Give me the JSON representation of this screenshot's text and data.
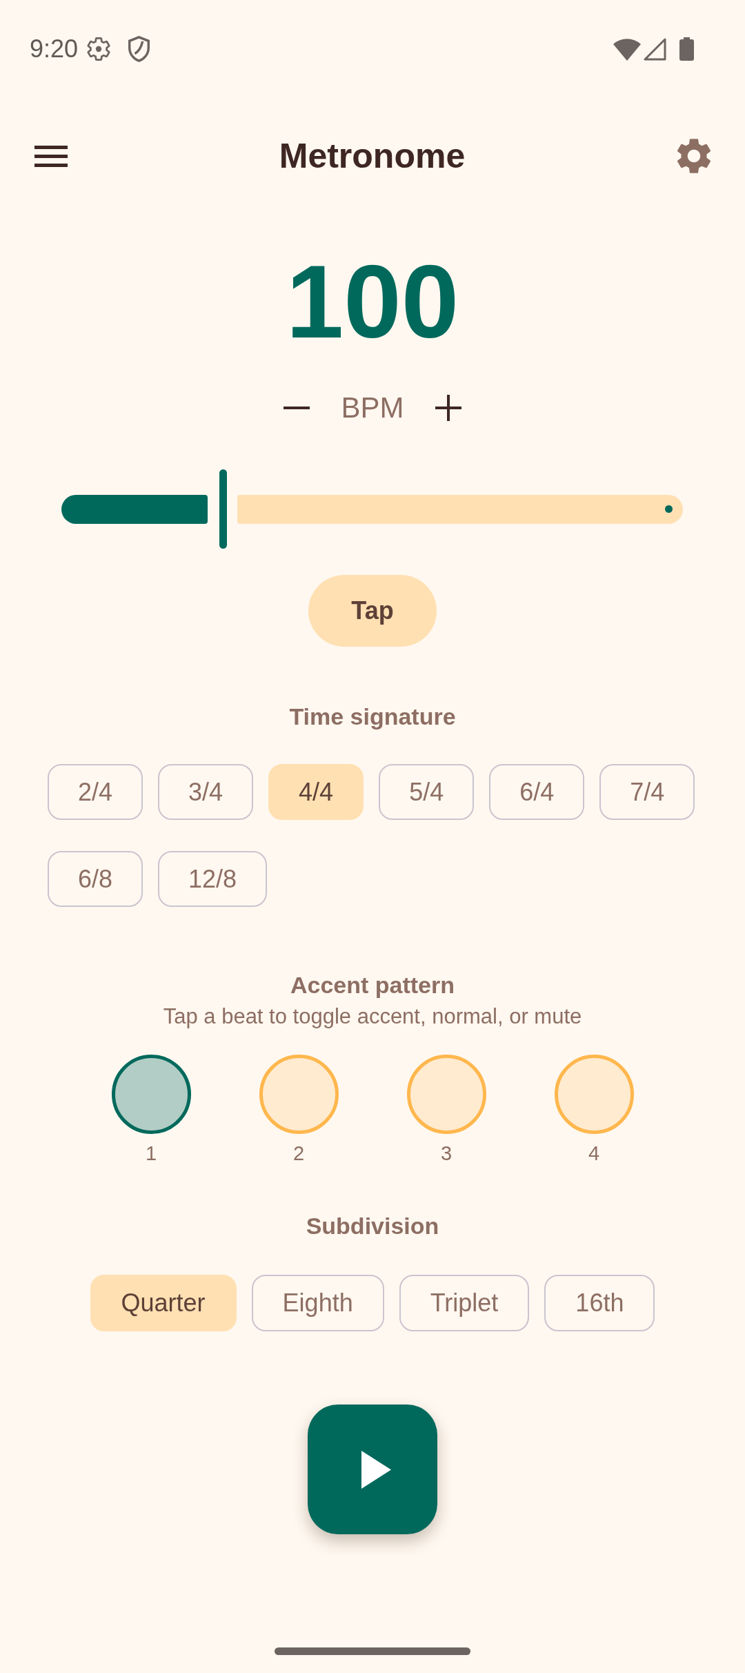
{
  "status_bar": {
    "time": "9:20"
  },
  "app_bar": {
    "title": "Metronome"
  },
  "tempo": {
    "value": "100",
    "unit": "BPM",
    "slider": {
      "level": 0.26
    }
  },
  "tap_button": {
    "label": "Tap"
  },
  "time_signature": {
    "title": "Time signature",
    "options": [
      {
        "label": "2/4",
        "selected": false
      },
      {
        "label": "3/4",
        "selected": false
      },
      {
        "label": "4/4",
        "selected": true
      },
      {
        "label": "5/4",
        "selected": false
      },
      {
        "label": "6/4",
        "selected": false
      },
      {
        "label": "7/4",
        "selected": false
      },
      {
        "label": "6/8",
        "selected": false
      },
      {
        "label": "12/8",
        "selected": false
      }
    ]
  },
  "accent_pattern": {
    "title": "Accent pattern",
    "hint": "Tap a beat to toggle accent, normal, or mute",
    "beats": [
      {
        "label": "1",
        "kind": "accent"
      },
      {
        "label": "2",
        "kind": "normal"
      },
      {
        "label": "3",
        "kind": "normal"
      },
      {
        "label": "4",
        "kind": "normal"
      }
    ]
  },
  "subdivision": {
    "title": "Subdivision",
    "options": [
      {
        "label": "Quarter",
        "selected": true
      },
      {
        "label": "Eighth",
        "selected": false
      },
      {
        "label": "Triplet",
        "selected": false
      },
      {
        "label": "16th",
        "selected": false
      }
    ]
  },
  "play_button": {
    "playing": false
  }
}
